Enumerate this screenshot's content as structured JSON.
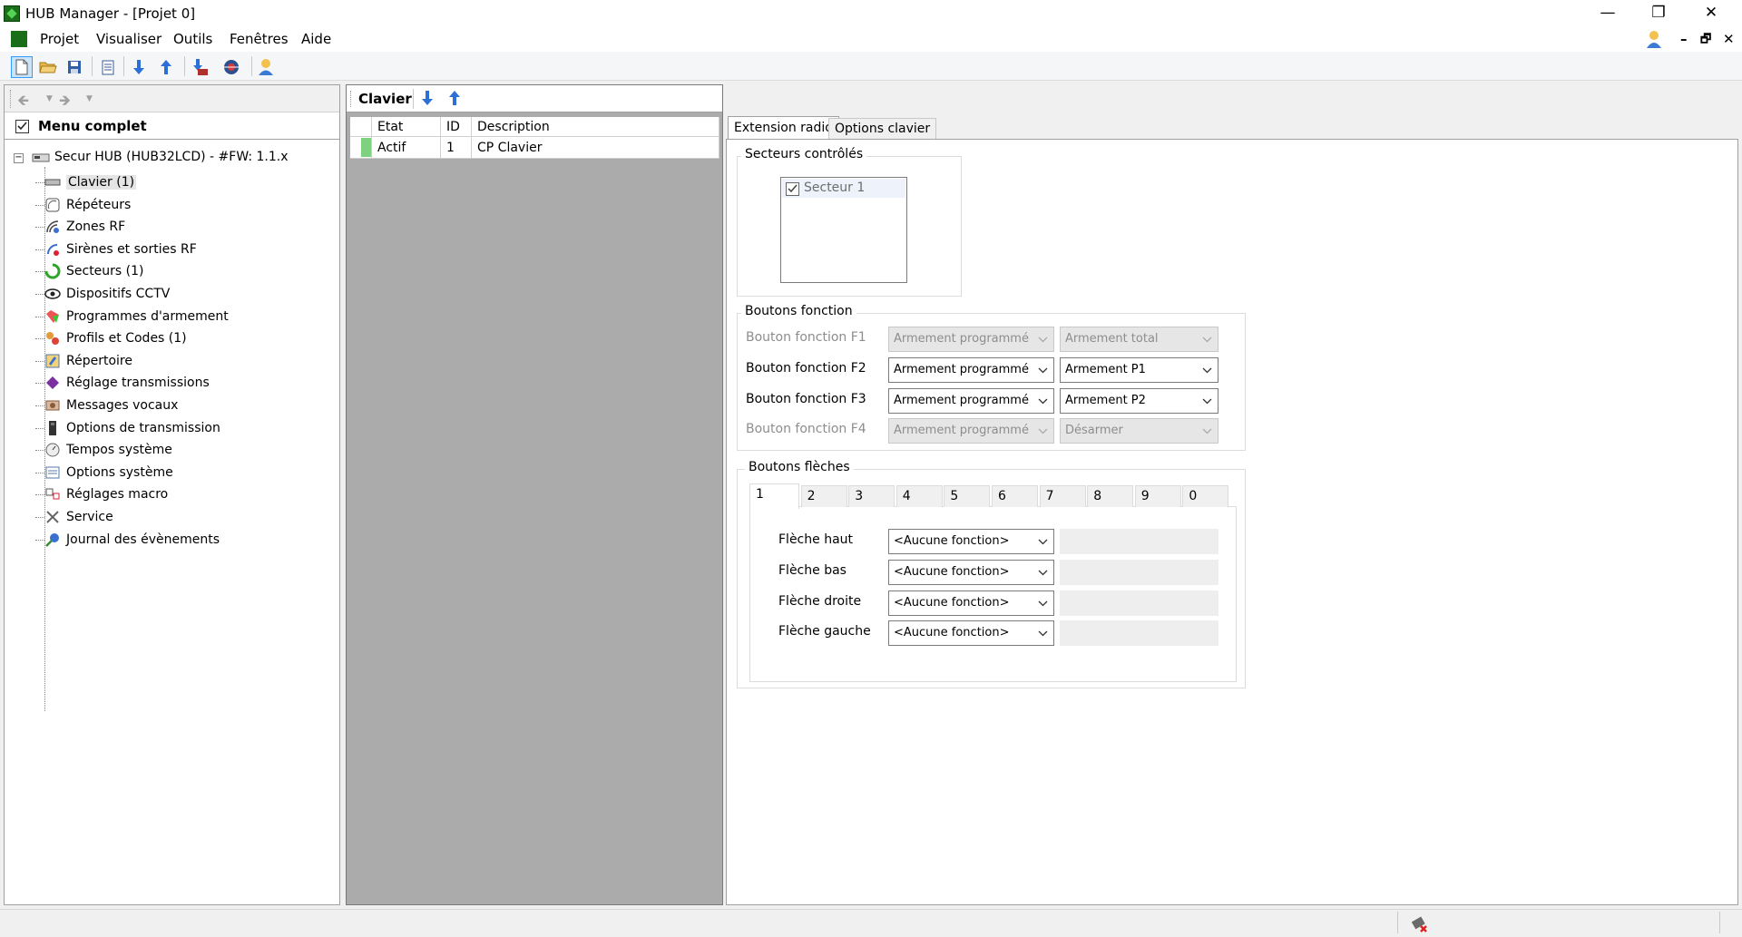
{
  "window": {
    "title": "HUB Manager - [Projet 0]",
    "minimize": "—",
    "restore": "❐",
    "close": "✕"
  },
  "menubar": {
    "items": [
      "Projet",
      "Visualiser",
      "Outils",
      "Fenêtres",
      "Aide"
    ],
    "mdi_minimize": "–",
    "mdi_restore": "🗗",
    "mdi_close": "✕"
  },
  "left": {
    "menu_complet": "Menu complet",
    "root": "Secur HUB (HUB32LCD) - #FW: 1.1.x",
    "tree": [
      {
        "label": "Clavier (1)",
        "icon": "keyboard-icon",
        "selected": true
      },
      {
        "label": "Répéteurs",
        "icon": "repeater-icon"
      },
      {
        "label": "Zones RF",
        "icon": "rf-zone-icon"
      },
      {
        "label": "Sirènes et sorties RF",
        "icon": "siren-icon"
      },
      {
        "label": "Secteurs (1)",
        "icon": "sectors-icon"
      },
      {
        "label": "Dispositifs CCTV",
        "icon": "eye-icon"
      },
      {
        "label": "Programmes d'armement",
        "icon": "schedule-icon"
      },
      {
        "label": "Profils et Codes (1)",
        "icon": "profiles-icon"
      },
      {
        "label": "Répertoire",
        "icon": "directory-icon"
      },
      {
        "label": "Réglage transmissions",
        "icon": "transmission-book-icon"
      },
      {
        "label": "Messages vocaux",
        "icon": "voice-icon"
      },
      {
        "label": "Options de transmission",
        "icon": "transmission-options-icon"
      },
      {
        "label": "Tempos système",
        "icon": "timer-icon"
      },
      {
        "label": "Options système",
        "icon": "system-options-icon"
      },
      {
        "label": "Réglages macro",
        "icon": "macro-icon"
      },
      {
        "label": "Service",
        "icon": "tools-icon"
      },
      {
        "label": "Journal des évènements",
        "icon": "event-log-icon"
      }
    ]
  },
  "middle": {
    "title": "Clavier",
    "columns": [
      "Etat",
      "ID",
      "Description"
    ],
    "rows": [
      {
        "etat": "Actif",
        "id": "1",
        "description": "CP Clavier"
      }
    ]
  },
  "right": {
    "tabs": [
      "Extension radio",
      "Options clavier"
    ],
    "secteurs": {
      "title": "Secteurs contrôlés",
      "items": [
        {
          "label": "Secteur 1",
          "checked": true
        }
      ]
    },
    "fonction": {
      "title": "Boutons fonction",
      "rows": [
        {
          "label": "Bouton fonction F1",
          "a": "Armement programmé",
          "b": "Armement total",
          "enabled": false
        },
        {
          "label": "Bouton fonction F2",
          "a": "Armement programmé",
          "b": "Armement P1",
          "enabled": true
        },
        {
          "label": "Bouton fonction F3",
          "a": "Armement programmé",
          "b": "Armement P2",
          "enabled": true
        },
        {
          "label": "Bouton fonction F4",
          "a": "Armement programmé",
          "b": "Désarmer",
          "enabled": false
        }
      ]
    },
    "fleches": {
      "title": "Boutons flèches",
      "tabs": [
        "1",
        "2",
        "3",
        "4",
        "5",
        "6",
        "7",
        "8",
        "9",
        "0"
      ],
      "rows": [
        {
          "label": "Flèche haut",
          "value": "<Aucune fonction>"
        },
        {
          "label": "Flèche bas",
          "value": "<Aucune fonction>"
        },
        {
          "label": "Flèche droite",
          "value": "<Aucune fonction>"
        },
        {
          "label": "Flèche gauche",
          "value": "<Aucune fonction>"
        }
      ]
    }
  },
  "colors": {
    "active_status": "#7ed17e",
    "accent": "#3399ff",
    "app_green": "#1a6e1a"
  }
}
